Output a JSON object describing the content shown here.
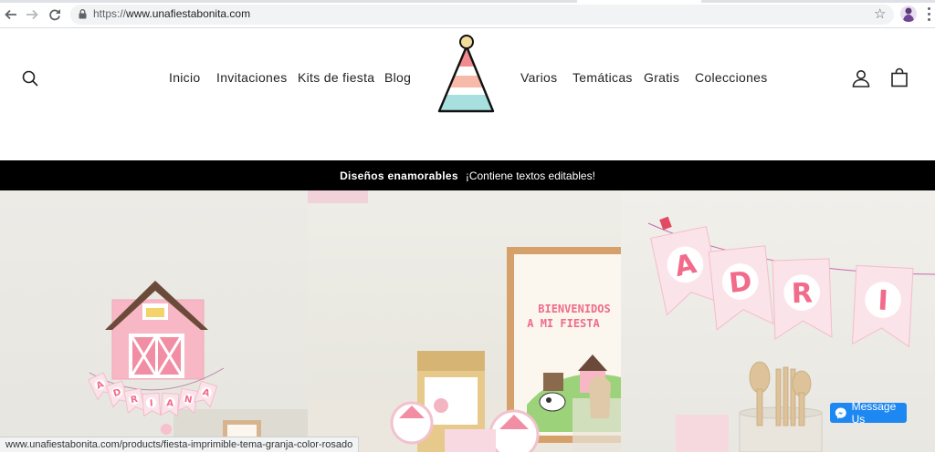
{
  "browser": {
    "url_scheme": "https://",
    "url_host": "www.unafiestabonita.com",
    "status_url": "www.unafiestabonita.com/products/fiesta-imprimible-tema-granja-color-rosado"
  },
  "nav": {
    "left": [
      "Inicio",
      "Invitaciones",
      "Kits de fiesta",
      "Blog"
    ],
    "right": [
      "Varios",
      "Temáticas",
      "Gratis",
      "Colecciones"
    ]
  },
  "announcement": {
    "bold": "Diseños enamorables",
    "text": "¡Contiene textos editables!"
  },
  "hero": {
    "panel1_banner_letters": [
      "A",
      "D",
      "R",
      "I",
      "A",
      "N",
      "A"
    ],
    "panel2_sign_line1": "BIENVENIDOS",
    "panel2_sign_line2": "A MI FIESTA",
    "panel3_banner_letters": [
      "A",
      "D",
      "R",
      "I"
    ]
  },
  "messenger": {
    "label": "Message Us"
  },
  "colors": {
    "announce_bg": "#000000",
    "messenger_blue": "#1e88f2",
    "barn_pink": "#f28ea3",
    "barn_roof": "#6b4a3a",
    "banner_pink": "#f26b8a"
  }
}
